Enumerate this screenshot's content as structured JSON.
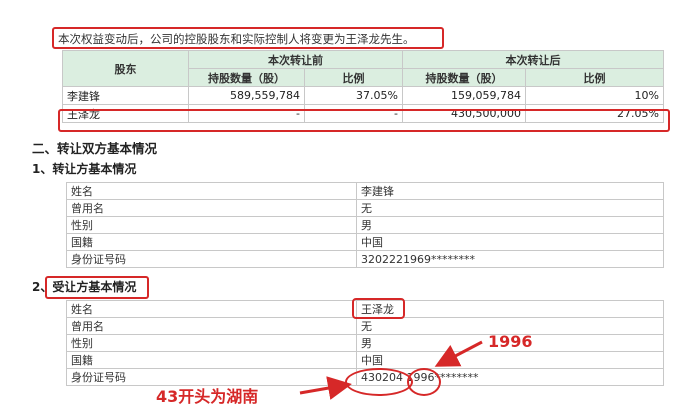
{
  "intro": "本次权益变动后，公司的控股股东和实际控制人将变更为王泽龙先生。",
  "equity_table": {
    "shareholder_header": "股东",
    "before_header": "本次转让前",
    "after_header": "本次转让后",
    "qty_header": "持股数量（股）",
    "ratio_header": "比例",
    "rows": [
      {
        "name": "李建锋",
        "before_qty": "589,559,784",
        "before_ratio": "37.05%",
        "after_qty": "159,059,784",
        "after_ratio": "10%"
      },
      {
        "name": "王泽龙",
        "before_qty": "-",
        "before_ratio": "-",
        "after_qty": "430,500,000",
        "after_ratio": "27.05%"
      }
    ]
  },
  "section2_title": "二、转让双方基本情况",
  "sub1_title": "1、转让方基本情况",
  "transferor": [
    {
      "k": "姓名",
      "v": "李建锋"
    },
    {
      "k": "曾用名",
      "v": "无"
    },
    {
      "k": "性别",
      "v": "男"
    },
    {
      "k": "国籍",
      "v": "中国"
    },
    {
      "k": "身份证号码",
      "v": "3202221969********"
    }
  ],
  "sub2_title": "2、受让方基本情况",
  "transferee": [
    {
      "k": "姓名",
      "v": "王泽龙"
    },
    {
      "k": "曾用名",
      "v": "无"
    },
    {
      "k": "性别",
      "v": "男"
    },
    {
      "k": "国籍",
      "v": "中国"
    },
    {
      "k": "身份证号码",
      "v": "430204 1996********"
    }
  ],
  "annotations": {
    "year": "1996",
    "hunan": "43开头为湖南"
  },
  "colors": {
    "accent": "#d62828",
    "header_bg": "#dbeee0"
  }
}
